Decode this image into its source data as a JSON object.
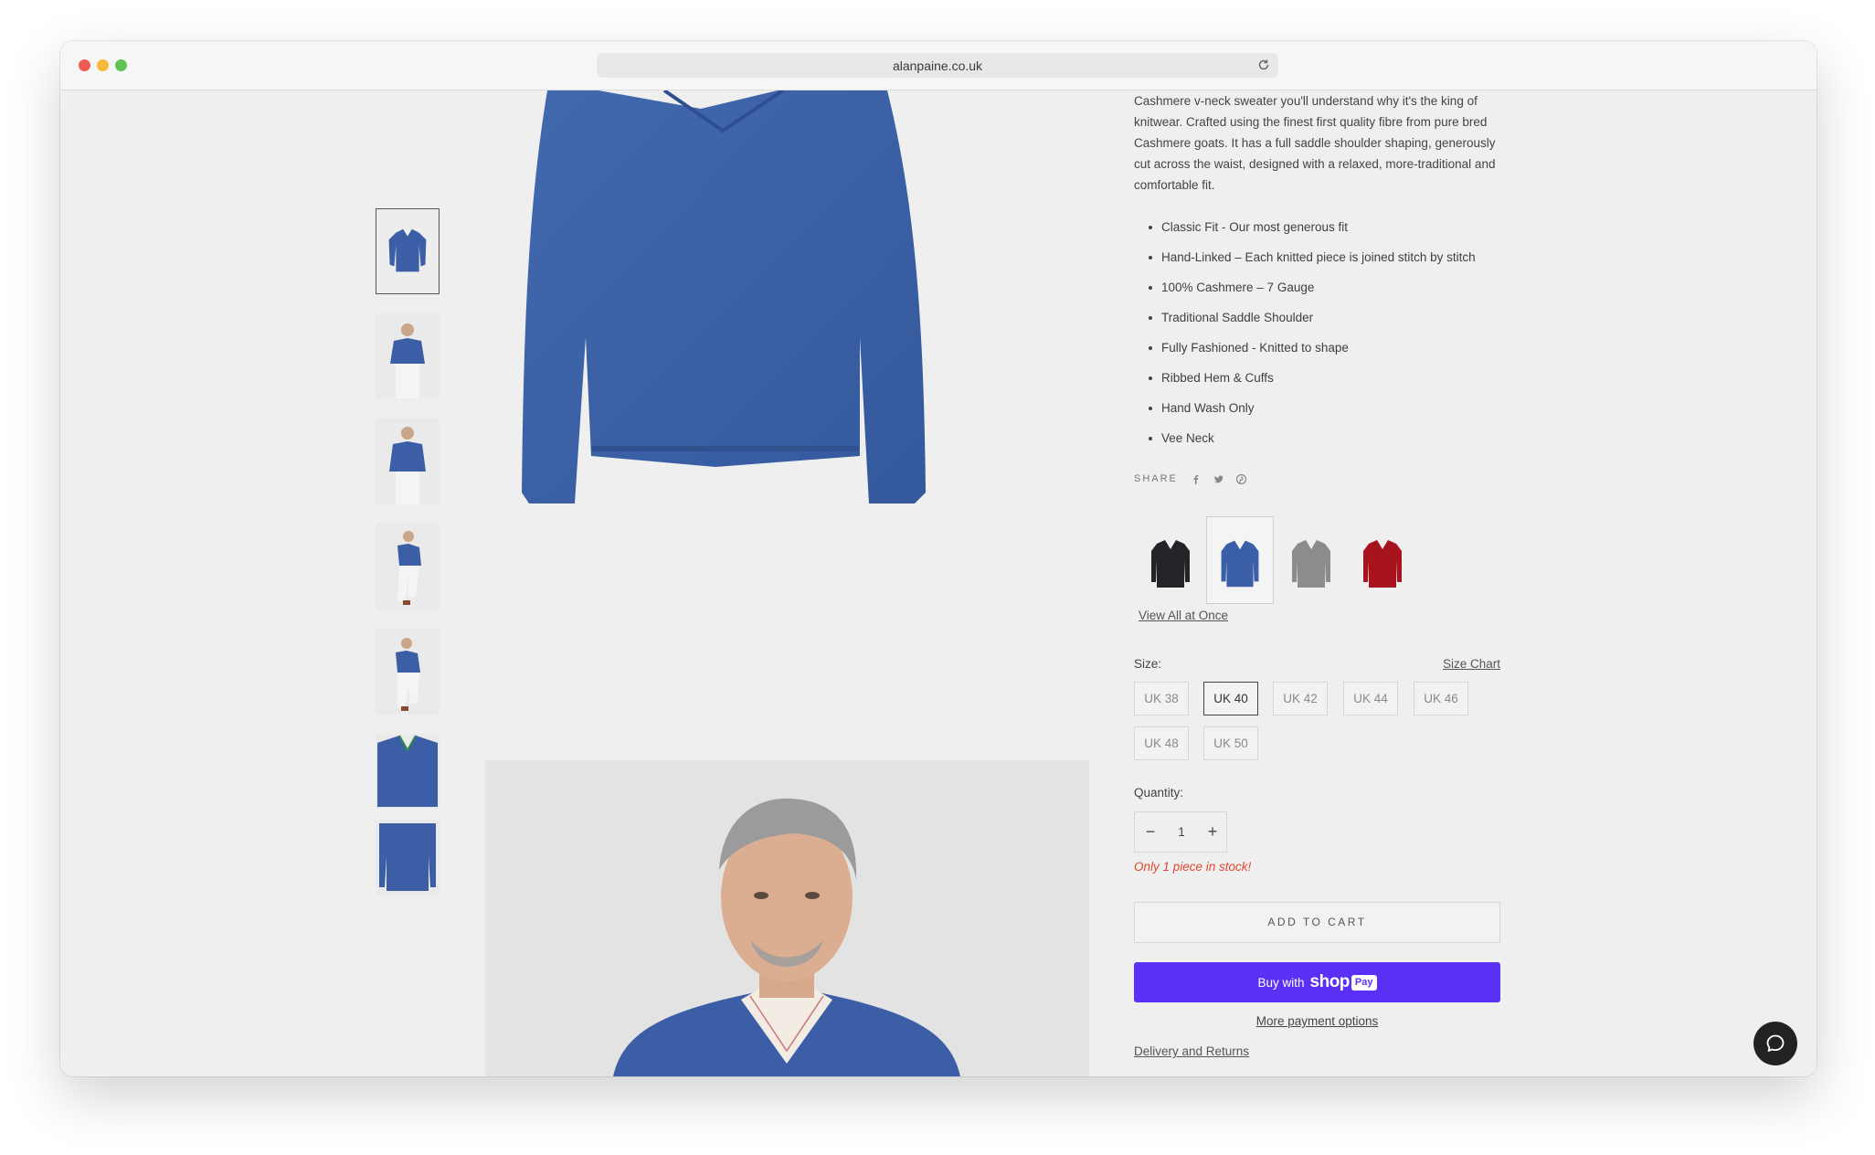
{
  "browser": {
    "url": "alanpaine.co.uk"
  },
  "product": {
    "description": "Cashmere v-neck sweater you'll understand why it's the king of knitwear. Crafted using the finest first quality fibre from pure bred Cashmere goats. It has a full saddle shoulder shaping, generously cut across the waist, designed with a relaxed, more-traditional and comfortable fit.",
    "features": [
      "Classic Fit - Our most generous fit",
      "Hand-Linked – Each knitted piece is joined stitch by stitch",
      "100% Cashmere – 7 Gauge",
      "Traditional Saddle Shoulder",
      "Fully Fashioned - Knitted to shape",
      "Ribbed Hem & Cuffs",
      "Hand Wash Only",
      "Vee Neck"
    ],
    "share_label": "SHARE",
    "colors": {
      "swatch_black": "#232428",
      "swatch_blue": "#3a5fa6",
      "swatch_grey": "#8c8c8c",
      "swatch_red": "#a8141e",
      "sweater_blue": "#3b5ea6",
      "shop_pay": "#5a31f4",
      "stock_note": "#e0482f"
    },
    "view_all_label": "View All at Once",
    "size_label": "Size:",
    "size_chart_label": "Size Chart",
    "sizes": [
      "UK 38",
      "UK 40",
      "UK 42",
      "UK 44",
      "UK 46",
      "UK 48",
      "UK 50"
    ],
    "selected_size": "UK 40",
    "quantity_label": "Quantity:",
    "quantity": "1",
    "qty_minus": "−",
    "qty_plus": "+",
    "stock_note": "Only 1 piece in stock!",
    "add_to_cart": "ADD TO CART",
    "buy_with": "Buy with",
    "shop_brand": "shop",
    "shop_pay_badge": "Pay",
    "more_payment": "More payment options",
    "delivery_returns": "Delivery and Returns"
  }
}
